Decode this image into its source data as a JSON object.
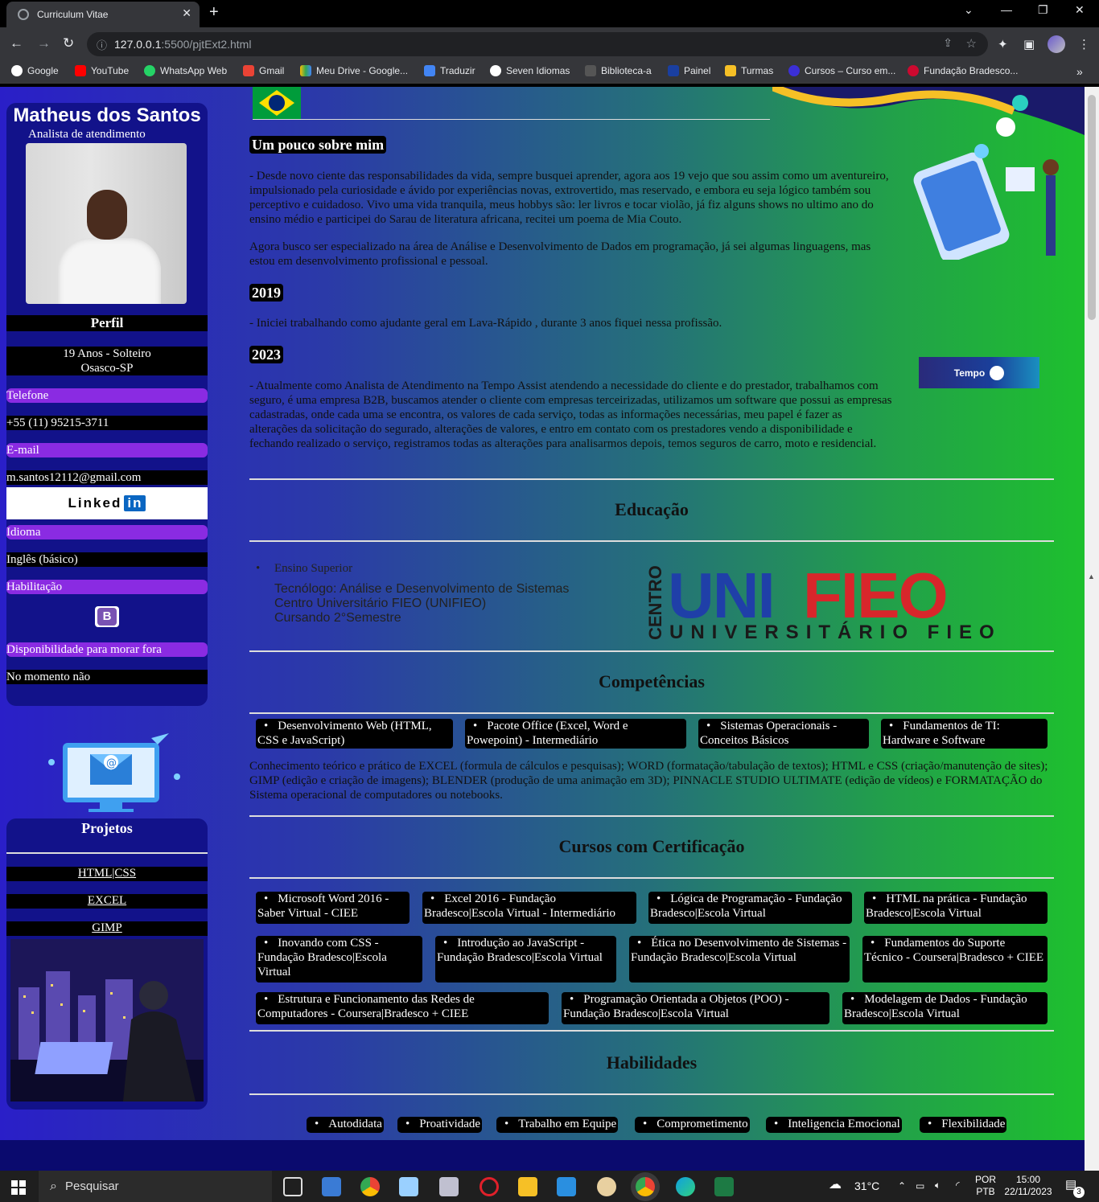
{
  "browser": {
    "tab_title": "Curriculum Vitae",
    "url_host": "127.0.0.1",
    "url_path": ":5500/pjtExt2.html",
    "bookmarks": [
      "Google",
      "YouTube",
      "WhatsApp Web",
      "Gmail",
      "Meu Drive - Google...",
      "Traduzir",
      "Seven Idiomas",
      "Biblioteca-a",
      "Painel",
      "Turmas",
      "Cursos – Curso em...",
      "Fundação Bradesco..."
    ]
  },
  "sidebar": {
    "name": "Matheus dos Santos",
    "role": "Analista de atendimento",
    "perfil": "Perfil",
    "age_status": "19 Anos - Solteiro",
    "city": "Osasco-SP",
    "phone_label": "Telefone",
    "phone": "+55 (11) 95215-3711",
    "email_label": "E-mail",
    "email": "m.santos12112@gmail.com",
    "linkedin_text": "Linked",
    "linkedin_in": "in",
    "language_label": "Idioma",
    "language": "Inglês (básico)",
    "license_label": "Habilitação",
    "license_badge": "B",
    "relocation_label": "Disponibilidade para morar fora",
    "relocation": "No momento não"
  },
  "projects": {
    "title": "Projetos",
    "links": [
      "HTML|CSS",
      "EXCEL",
      "GIMP"
    ]
  },
  "main": {
    "about_title": "Um pouco sobre mim",
    "about_p1": "- Desde novo ciente das responsabilidades da vida, sempre busquei aprender, agora aos 19 vejo que sou assim como um aventureiro, impulsionado pela curiosidade e ávido por experiências novas, extrovertido, mas reservado, e embora eu seja lógico também sou perceptivo e cuidadoso. Vivo uma vida tranquila, meus hobbys são: ler livros e tocar violão, já fiz alguns shows no ultimo ano do ensino médio e participei do Sarau de literatura africana, recitei um poema de Mia Couto.",
    "about_p2": "Agora busco ser especializado na área de Análise e Desenvolvimento de Dados em programação, já sei algumas linguagens, mas estou em desenvolvimento profissional e pessoal.",
    "y2019": "2019",
    "y2019_text": "- Iniciei trabalhando como ajudante geral em Lava-Rápido , durante 3 anos fiquei nessa profissão.",
    "y2023": "2023",
    "y2023_text": "- Atualmente como Analista de Atendimento na Tempo Assist atendendo a necessidade do cliente e do prestador, trabalhamos com seguro, é uma empresa B2B, buscamos atender o cliente com empresas terceirizadas, utilizamos um software que possui as empresas cadastradas, onde cada uma se encontra, os valores de cada serviço, todas as informações necessárias, meu papel é fazer as alterações da solicitação do segurado, alterações de valores, e entro em contato com os prestadores vendo a disponibilidade e fechando realizado o serviço, registramos todas as alterações para analisarmos depois, temos seguros de carro, moto e residencial.",
    "tempo_logo": "Tempo",
    "edu_title": "Educação",
    "edu_item": "Ensino Superior",
    "edu_course": "Tecnólogo: Análise e Desenvolvimento de Sistemas",
    "edu_school": "Centro Universitário FIEO (UNIFIEO)",
    "edu_status": "Cursando 2°Semestre",
    "unifieo_centro": "CENTRO",
    "unifieo_uni": "UNI",
    "unifieo_fieo": "FIEO",
    "unifieo_sub": "UNIVERSITÁRIO FIEO",
    "comp_title": "Competências",
    "comp_items": [
      "Desenvolvimento Web (HTML, CSS e JavaScript)",
      "Pacote Office (Excel, Word e Powepoint) - Intermediário",
      "Sistemas Operacionais - Conceitos Básicos",
      "Fundamentos de TI: Hardware e Software"
    ],
    "comp_text": "Conhecimento teórico e prático de EXCEL (formula de cálculos e pesquisas); WORD (formatação/tabulação de textos); HTML e CSS (criação/manutenção de sites); GIMP (edição e criação de imagens); BLENDER (produção de uma animação em 3D); PINNACLE STUDIO ULTIMATE (edição de vídeos) e FORMATAÇÃO do Sistema operacional de computadores ou notebooks.",
    "cert_title": "Cursos com Certificação",
    "cert_items": [
      "Microsoft Word 2016 - Saber Virtual - CIEE",
      "Excel 2016 - Fundação Bradesco|Escola Virtual - Intermediário",
      "Lógica de Programação - Fundação Bradesco|Escola Virtual",
      "HTML na prática - Fundação Bradesco|Escola Virtual",
      "Inovando com CSS - Fundação Bradesco|Escola Virtual",
      "Introdução ao JavaScript - Fundação Bradesco|Escola Virtual",
      "Ética no Desenvolvimento de Sistemas - Fundação Bradesco|Escola Virtual",
      "Fundamentos do Suporte Técnico - Coursera|Bradesco + CIEE",
      "Estrutura e Funcionamento das Redes de Computadores - Coursera|Bradesco + CIEE",
      "Programação Orientada a Objetos (POO) - Fundação Bradesco|Escola Virtual",
      "Modelagem de Dados - Fundação Bradesco|Escola Virtual"
    ],
    "skills_title": "Habilidades",
    "skills": [
      "Autodidata",
      "Proatividade",
      "Trabalho em Equipe",
      "Comprometimento",
      "Inteligencia Emocional",
      "Flexibilidade"
    ]
  },
  "taskbar": {
    "search_placeholder": "Pesquisar",
    "weather": "31°C",
    "lang1": "POR",
    "lang2": "PTB",
    "time": "15:00",
    "date": "22/11/2023",
    "notif_count": "3"
  }
}
